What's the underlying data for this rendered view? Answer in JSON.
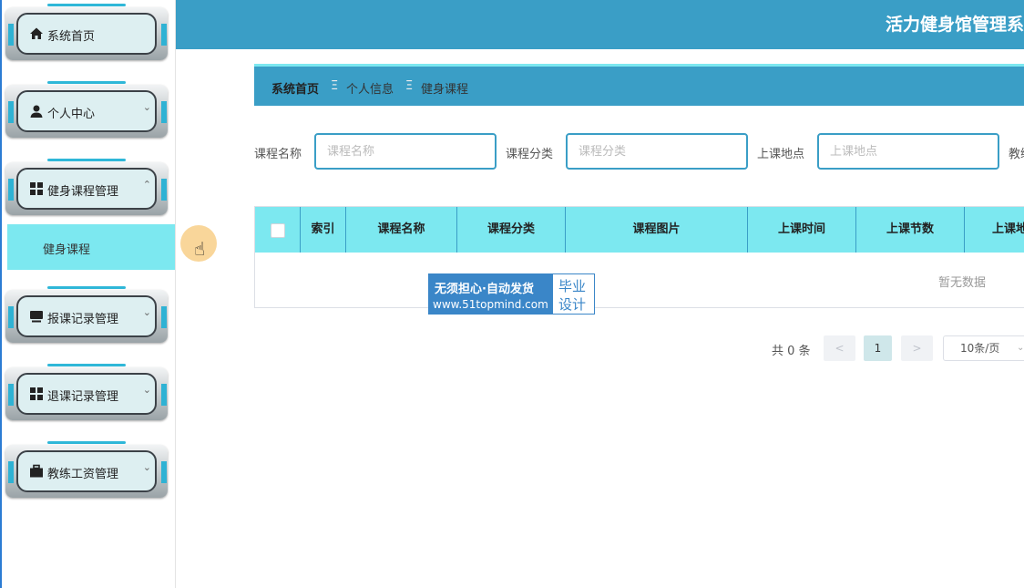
{
  "header": {
    "title": "活力健身馆管理系"
  },
  "sidebar": {
    "items": [
      {
        "label": "系统首页",
        "icon": "home-icon"
      },
      {
        "label": "个人中心",
        "icon": "user-icon"
      },
      {
        "label": "健身课程管理",
        "icon": "grid-icon"
      },
      {
        "label": "报课记录管理",
        "icon": "monitor-icon"
      },
      {
        "label": "退课记录管理",
        "icon": "grid-icon"
      },
      {
        "label": "教练工资管理",
        "icon": "briefcase-icon"
      }
    ],
    "submenu": {
      "label": "健身课程"
    }
  },
  "breadcrumb": {
    "home": "系统首页",
    "level2": "个人信息",
    "current": "健身课程",
    "separator": "Ξ"
  },
  "search": {
    "name_label": "课程名称",
    "name_placeholder": "课程名称",
    "category_label": "课程分类",
    "category_placeholder": "课程分类",
    "location_label": "上课地点",
    "location_placeholder": "上课地点",
    "coach_label_partial": "教练"
  },
  "table": {
    "headers": [
      "索引",
      "课程名称",
      "课程分类",
      "课程图片",
      "上课时间",
      "上课节数",
      "上课地点"
    ],
    "empty_text": "暂无数据"
  },
  "pagination": {
    "total": "共 0 条",
    "prev": "<",
    "current": "1",
    "next": ">",
    "page_size": "10条/页"
  },
  "watermark": {
    "line1": "无须担心·自动发货",
    "line2": "www.51topmind.com",
    "tag1": "毕业",
    "tag2": "设计"
  },
  "colors": {
    "header": "#3a9ec6",
    "accent": "#7ce8f0"
  }
}
